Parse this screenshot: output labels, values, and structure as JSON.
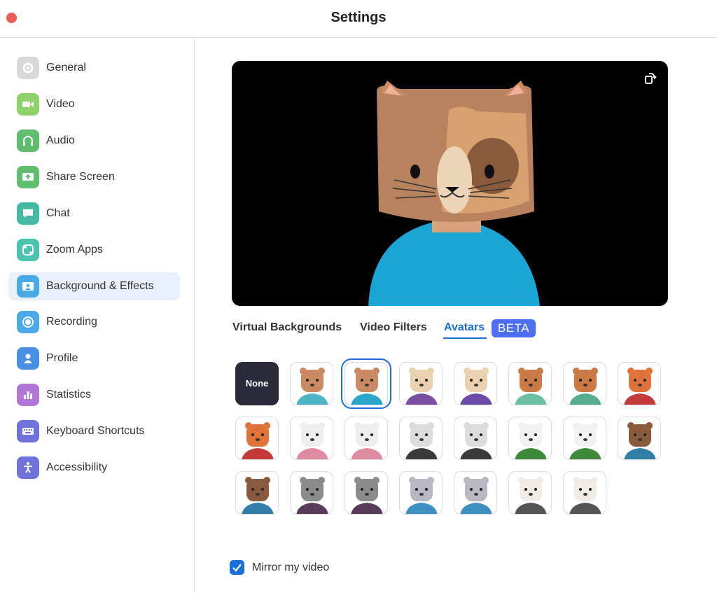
{
  "window": {
    "title": "Settings",
    "close_color": "#ee5c55"
  },
  "sidebar": {
    "items": [
      {
        "label": "General",
        "icon": "gear-icon",
        "color": "#d9d9d9",
        "active": false
      },
      {
        "label": "Video",
        "icon": "camera-icon",
        "color": "#8fd16a",
        "active": false
      },
      {
        "label": "Audio",
        "icon": "headphones-icon",
        "color": "#5fbf6e",
        "active": false
      },
      {
        "label": "Share Screen",
        "icon": "share-screen-icon",
        "color": "#5fbf6e",
        "active": false
      },
      {
        "label": "Chat",
        "icon": "chat-icon",
        "color": "#46b8a4",
        "active": false
      },
      {
        "label": "Zoom Apps",
        "icon": "apps-icon",
        "color": "#4cc2b0",
        "active": false
      },
      {
        "label": "Background & Effects",
        "icon": "background-icon",
        "color": "#4aa9e6",
        "active": true
      },
      {
        "label": "Recording",
        "icon": "record-icon",
        "color": "#4aa9e6",
        "active": false
      },
      {
        "label": "Profile",
        "icon": "person-icon",
        "color": "#4a8fe6",
        "active": false
      },
      {
        "label": "Statistics",
        "icon": "bar-chart-icon",
        "color": "#b077d6",
        "active": false
      },
      {
        "label": "Keyboard Shortcuts",
        "icon": "keyboard-icon",
        "color": "#6f72d9",
        "active": false
      },
      {
        "label": "Accessibility",
        "icon": "accessibility-icon",
        "color": "#6f72d9",
        "active": false
      }
    ]
  },
  "preview": {
    "icon": "rotate-camera-icon"
  },
  "tabs": [
    {
      "label": "Virtual Backgrounds",
      "active": false
    },
    {
      "label": "Video Filters",
      "active": false
    },
    {
      "label": "Avatars",
      "active": true
    }
  ],
  "beta_badge": "BETA",
  "avatars": {
    "none_label": "None",
    "selected_index": 1,
    "items": [
      {
        "name": "cat-teal-avatar",
        "head": "#c98a64",
        "shirt": "#4fb3c8"
      },
      {
        "name": "cat-cyan-avatar",
        "head": "#c98a64",
        "shirt": "#2aa7c9"
      },
      {
        "name": "cow-purple-avatar",
        "head": "#ead2b0",
        "shirt": "#7a4fa2"
      },
      {
        "name": "cow-violet-avatar",
        "head": "#ead2b0",
        "shirt": "#6b4aa8"
      },
      {
        "name": "dog-mint-avatar",
        "head": "#c97a45",
        "shirt": "#6dbfa2"
      },
      {
        "name": "dog-green-avatar",
        "head": "#c97a45",
        "shirt": "#54ad8e"
      },
      {
        "name": "fox-red-avatar",
        "head": "#e0733a",
        "shirt": "#c43a3a"
      },
      {
        "name": "fox-crimson-avatar",
        "head": "#e0733a",
        "shirt": "#c43a3a"
      },
      {
        "name": "rabbit-pink-avatar",
        "head": "#eeeeee",
        "shirt": "#e08aa0"
      },
      {
        "name": "rabbit-rose-avatar",
        "head": "#eeeeee",
        "shirt": "#e08aa0"
      },
      {
        "name": "polar-bear-dark-avatar",
        "head": "#dcdcdc",
        "shirt": "#3a3a3a"
      },
      {
        "name": "polar-bear-black-avatar",
        "head": "#dcdcdc",
        "shirt": "#3a3a3a"
      },
      {
        "name": "panda-green-avatar",
        "head": "#f2f2f2",
        "shirt": "#3e8a3a"
      },
      {
        "name": "panda-olive-avatar",
        "head": "#f2f2f2",
        "shirt": "#3e8a3a"
      },
      {
        "name": "beaver-blue-avatar",
        "head": "#8a5a3c",
        "shirt": "#2f7fa8"
      },
      {
        "name": "beaver-navy-avatar",
        "head": "#8a5a3c",
        "shirt": "#2f7fa8"
      },
      {
        "name": "raccoon-plum-avatar",
        "head": "#8b8b8b",
        "shirt": "#5a3a5a"
      },
      {
        "name": "raccoon-purple-avatar",
        "head": "#8b8b8b",
        "shirt": "#5a3a5a"
      },
      {
        "name": "mouse-sky-avatar",
        "head": "#b8b8c4",
        "shirt": "#3d8fc0"
      },
      {
        "name": "mouse-blue-avatar",
        "head": "#b8b8c4",
        "shirt": "#3d8fc0"
      },
      {
        "name": "cow-gray-avatar",
        "head": "#f0ece4",
        "shirt": "#555555"
      },
      {
        "name": "cow-charcoal-avatar",
        "head": "#f0ece4",
        "shirt": "#555555"
      }
    ]
  },
  "mirror": {
    "label": "Mirror my video",
    "checked": true,
    "accent": "#1a6ed8"
  }
}
